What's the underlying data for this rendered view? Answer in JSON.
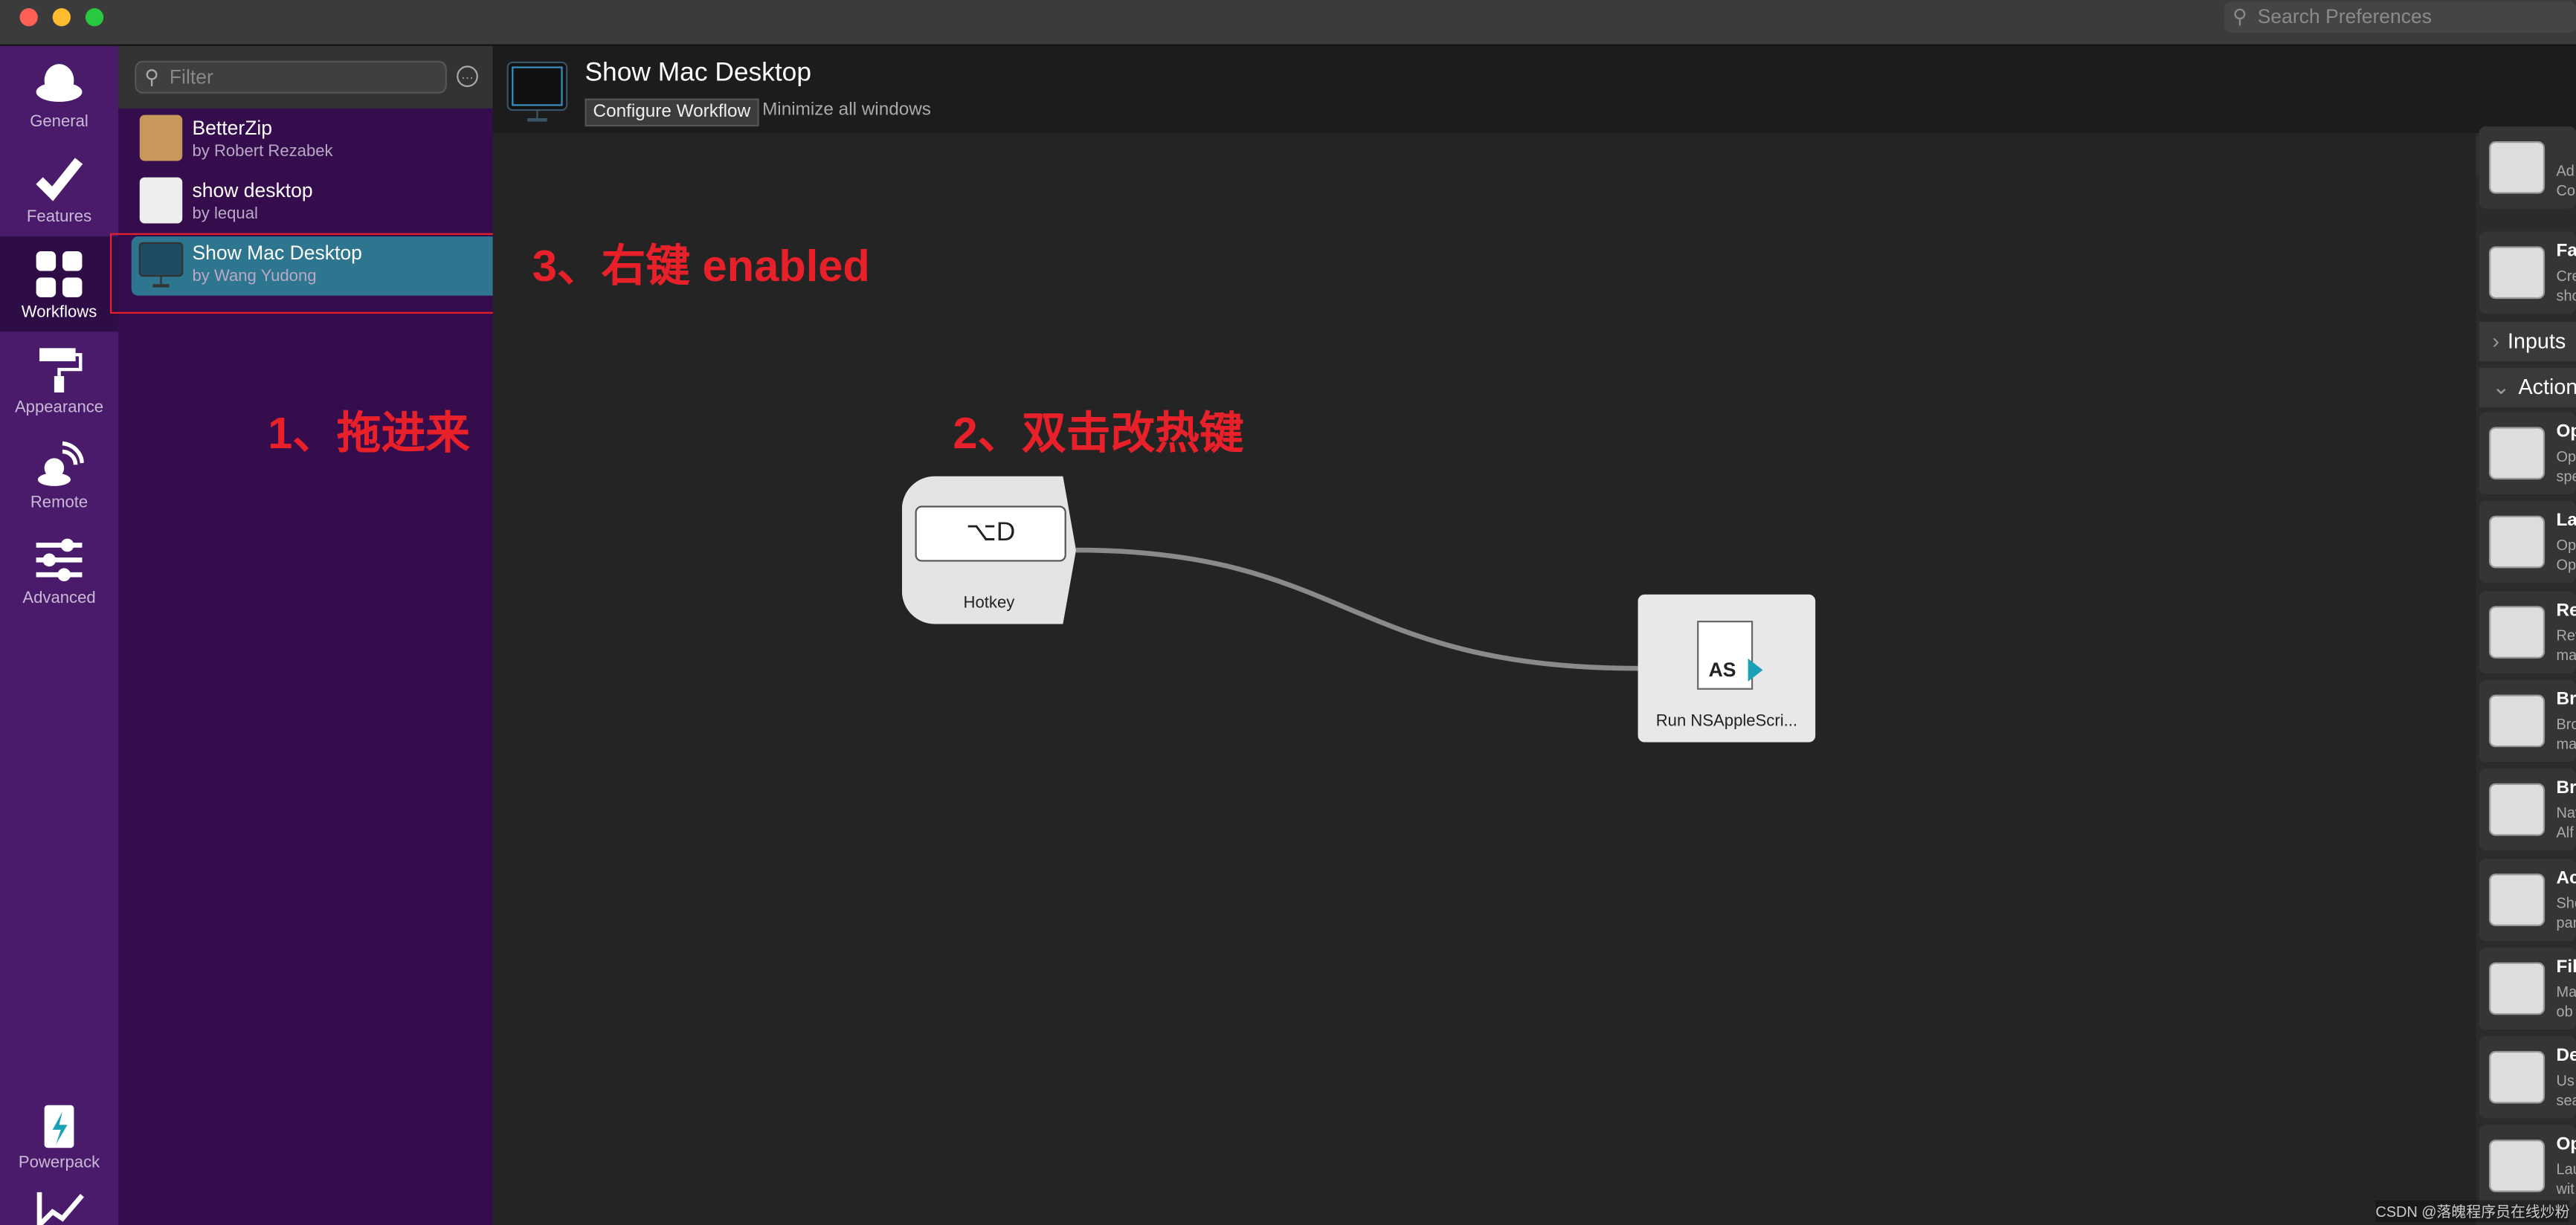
{
  "window": {
    "search_placeholder": "Search Preferences"
  },
  "nav": [
    {
      "label": "General",
      "icon": "hat-icon"
    },
    {
      "label": "Features",
      "icon": "checkmark-icon"
    },
    {
      "label": "Workflows",
      "icon": "grid-icon",
      "selected": true
    },
    {
      "label": "Appearance",
      "icon": "paint-roller-icon"
    },
    {
      "label": "Remote",
      "icon": "remote-icon"
    },
    {
      "label": "Advanced",
      "icon": "sliders-icon"
    },
    {
      "label": "Powerpack",
      "icon": "battery-bolt-icon"
    }
  ],
  "list": {
    "filter_placeholder": "Filter",
    "items": [
      {
        "title": "BetterZip",
        "author": "by Robert Rezabek"
      },
      {
        "title": "show desktop",
        "author": "by lequal"
      },
      {
        "title": "Show Mac Desktop",
        "author": "by Wang Yudong",
        "selected": true
      }
    ]
  },
  "workflow": {
    "title": "Show Mac Desktop",
    "configure_label": "Configure Workflow",
    "description": "Minimize all windows"
  },
  "nodes": {
    "hotkey_keys": "⌥D",
    "hotkey_label": "Hotkey",
    "script_badge": "AS",
    "script_label": "Run NSAppleScri..."
  },
  "palette": {
    "top_cards": [
      {
        "title": "",
        "sub": "Ad\nCo"
      },
      {
        "title": "Fa",
        "sub": "Cre\nsho"
      }
    ],
    "sections": [
      {
        "label": "Inputs",
        "expanded": false
      },
      {
        "label": "Actions",
        "expanded": true
      }
    ],
    "actions": [
      {
        "title": "Op",
        "sub": "Op\nspe"
      },
      {
        "title": "La",
        "sub": "Op\nOp"
      },
      {
        "title": "Re",
        "sub": "Rev\nma"
      },
      {
        "title": "Bro",
        "sub": "Bro\nma"
      },
      {
        "title": "Bro",
        "sub": "Nav\nAlf"
      },
      {
        "title": "Ac",
        "sub": "Sho\npar"
      },
      {
        "title": "Fil",
        "sub": "Ma\nob"
      },
      {
        "title": "De",
        "sub": "Us\nsea"
      },
      {
        "title": "Op",
        "sub": "Lau\nwit"
      }
    ]
  },
  "annotations": {
    "step1": "1、拖进来",
    "step2": "2、双击改热键",
    "step3": "3、右键 enabled"
  },
  "watermark": "CSDN @落魄程序员在线炒粉",
  "colors": {
    "accent": "#2e758f",
    "sidebar": "#4a1a6b",
    "annotation": "#e8202a"
  }
}
